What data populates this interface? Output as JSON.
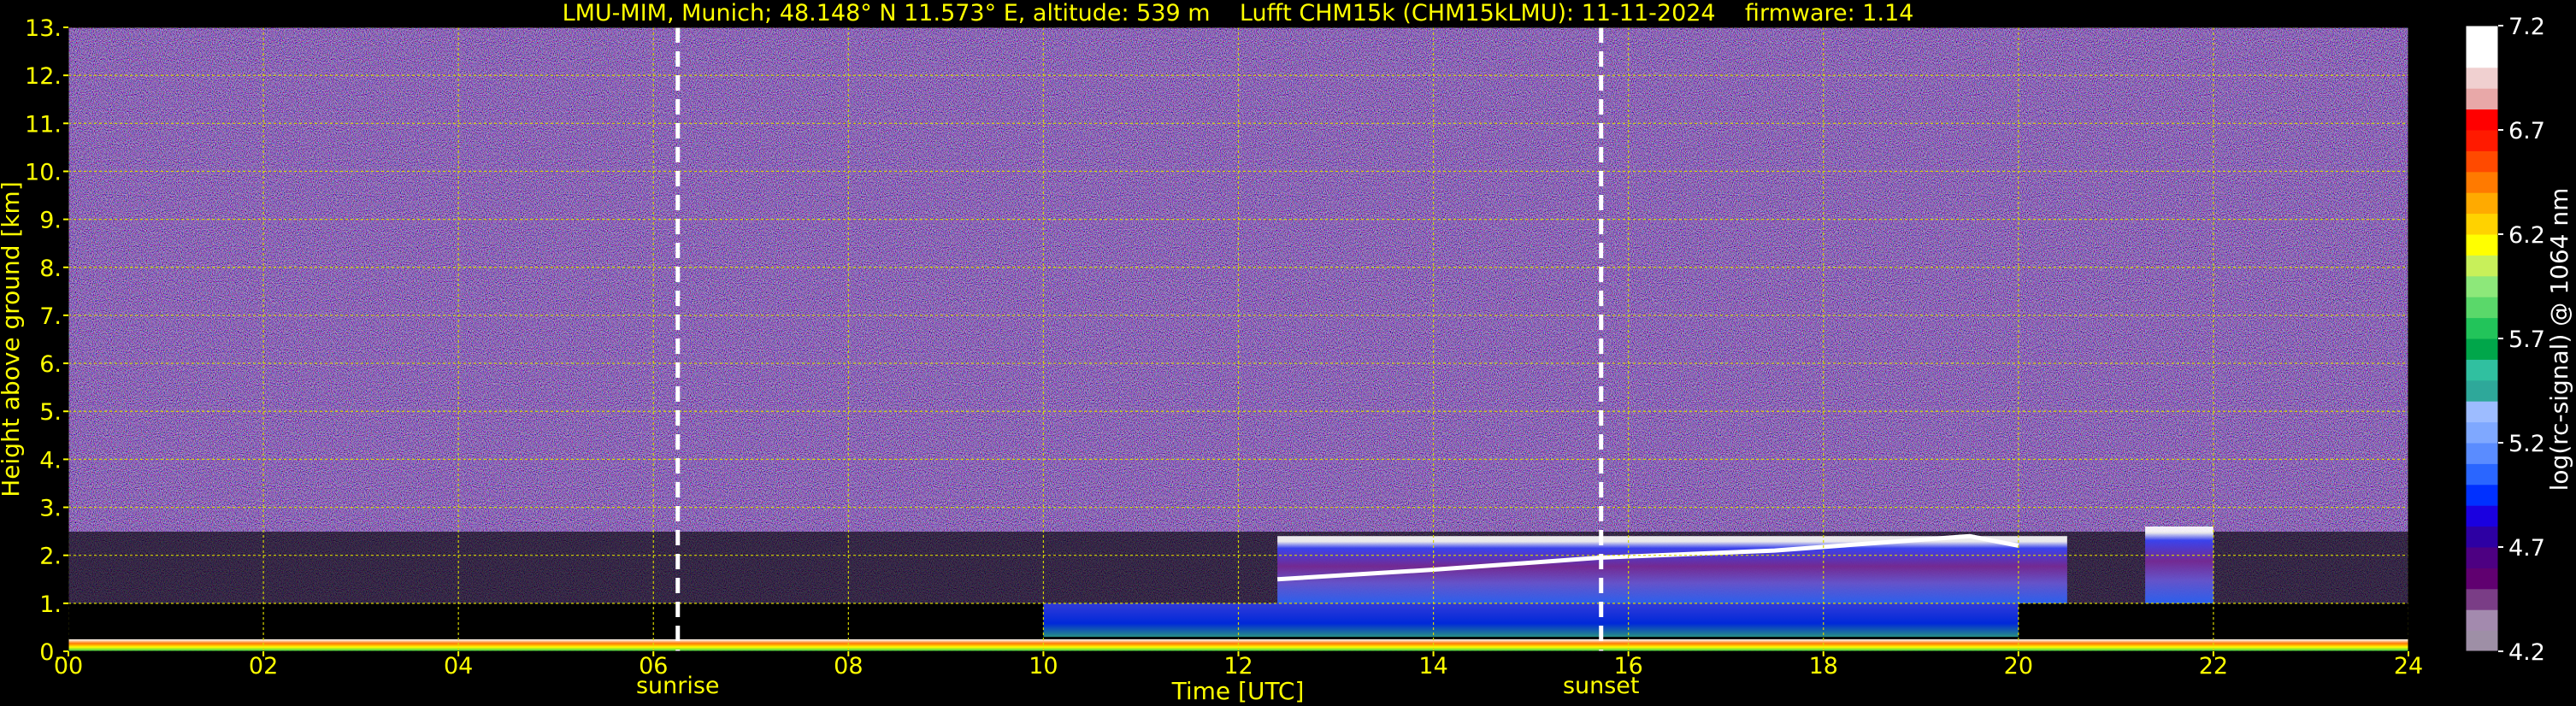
{
  "chart_data": {
    "type": "heatmap",
    "title": "LMU-MIM, Munich; 48.148° N 11.573° E, altitude: 539 m    Lufft CHM15k (CHM15kLMU): 11-11-2024    firmware: 1.14",
    "xlabel": "Time [UTC]",
    "ylabel": "Height above ground [km]",
    "xlim": [
      0,
      24
    ],
    "ylim": [
      0,
      13
    ],
    "x_ticks": [
      "00",
      "02",
      "04",
      "06",
      "08",
      "10",
      "12",
      "14",
      "16",
      "18",
      "20",
      "22",
      "24"
    ],
    "y_ticks": [
      "0.",
      "1.",
      "2.",
      "3.",
      "4.",
      "5.",
      "6.",
      "7.",
      "8.",
      "9.",
      "10.",
      "11.",
      "12.",
      "13."
    ],
    "grid": true,
    "colorbar": {
      "label": "log(rc-signal) @ 1064 nm",
      "range": [
        4.2,
        7.2
      ],
      "ticks": [
        "4.2",
        "4.7",
        "5.2",
        "5.7",
        "6.2",
        "6.7",
        "7.2"
      ],
      "colors": [
        "#9e8fa6",
        "#a38aae",
        "#7a3d86",
        "#600070",
        "#4d0082",
        "#2d00a3",
        "#1a00e0",
        "#0030ff",
        "#2a66ff",
        "#5a8cff",
        "#7fa8ff",
        "#9dbcff",
        "#2ea89a",
        "#30c0a0",
        "#00a64a",
        "#22c45a",
        "#5ad86a",
        "#8de87a",
        "#c8f05a",
        "#ffff00",
        "#ffd200",
        "#ffaa00",
        "#ff7a00",
        "#ff4a00",
        "#ff1a00",
        "#ff0000",
        "#e8a8a8",
        "#f0d0d0",
        "#ffffff",
        "#ffffff"
      ]
    },
    "markers": [
      {
        "name": "sunrise",
        "x": 6.25
      },
      {
        "name": "sunset",
        "x": 15.72
      }
    ],
    "layers": [
      {
        "kind": "noise",
        "x": [
          0,
          24
        ],
        "y": [
          2.5,
          13.0
        ]
      },
      {
        "kind": "noise-sparse",
        "x": [
          0,
          24
        ],
        "y": [
          1.0,
          2.5
        ]
      },
      {
        "kind": "surface-layer",
        "x": [
          0,
          24
        ],
        "y": [
          0.0,
          0.25
        ]
      },
      {
        "kind": "aerosol-layer",
        "x": [
          10.0,
          20.0
        ],
        "y": [
          0.3,
          1.0
        ]
      },
      {
        "kind": "cloud-layer",
        "x": [
          12.4,
          20.5
        ],
        "y": [
          1.0,
          2.4
        ]
      },
      {
        "kind": "cloud-layer",
        "x": [
          21.3,
          22.0
        ],
        "y": [
          1.0,
          2.6
        ]
      }
    ],
    "cloud_top_km": [
      {
        "x": 12.4,
        "y": 1.5
      },
      {
        "x": 14.0,
        "y": 1.7
      },
      {
        "x": 15.7,
        "y": 1.95
      },
      {
        "x": 17.5,
        "y": 2.1
      },
      {
        "x": 19.5,
        "y": 2.4
      },
      {
        "x": 20.0,
        "y": 2.2
      }
    ]
  }
}
